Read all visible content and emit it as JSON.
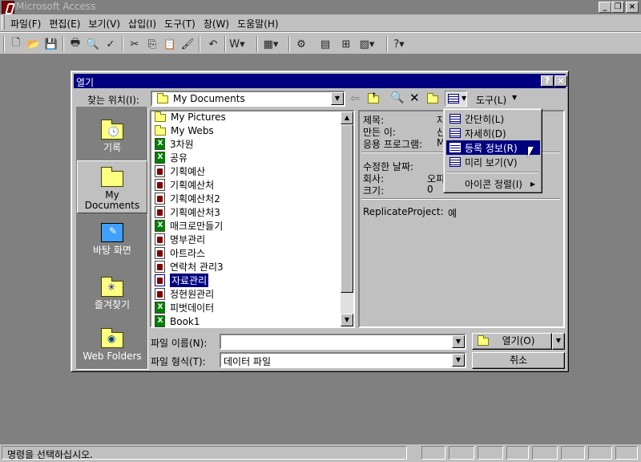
{
  "app": {
    "title": "Microsoft Access"
  },
  "menu": [
    "파일(F)",
    "편집(E)",
    "보기(V)",
    "삽입(I)",
    "도구(T)",
    "창(W)",
    "도움말(H)"
  ],
  "dialog": {
    "title": "열기",
    "help_btn": "?",
    "close_btn": "×",
    "look_in_label": "찾는 위치(I):",
    "look_in_value": "My Documents",
    "tools_label": "도구(L)",
    "places": [
      {
        "label": "기록",
        "icon": "history-folder-icon"
      },
      {
        "label": "My Documents",
        "icon": "my-documents-folder-icon"
      },
      {
        "label": "바탕 화면",
        "icon": "desktop-icon"
      },
      {
        "label": "즐겨찾기",
        "icon": "favorites-folder-icon"
      },
      {
        "label": "Web Folders",
        "icon": "web-folders-icon"
      }
    ],
    "files": [
      {
        "name": "My Pictures",
        "type": "folder"
      },
      {
        "name": "My Webs",
        "type": "folder"
      },
      {
        "name": "3차원",
        "type": "xls"
      },
      {
        "name": "공유",
        "type": "xls"
      },
      {
        "name": "기획예산",
        "type": "mdb"
      },
      {
        "name": "기획예산처",
        "type": "mdb"
      },
      {
        "name": "기획예산처2",
        "type": "mdb"
      },
      {
        "name": "기획예산처3",
        "type": "mdb"
      },
      {
        "name": "매크로만들기",
        "type": "xls"
      },
      {
        "name": "명부관리",
        "type": "mdb"
      },
      {
        "name": "아트라스",
        "type": "mdb"
      },
      {
        "name": "연락처 관리3",
        "type": "mdb"
      },
      {
        "name": "자료관리",
        "type": "mdb",
        "selected": true
      },
      {
        "name": "정현원관리",
        "type": "mdb"
      },
      {
        "name": "피벗데이터",
        "type": "xls"
      },
      {
        "name": "Book1",
        "type": "xls"
      }
    ],
    "properties": {
      "title_label": "제목:",
      "title_value": "자",
      "author_label": "만든 이:",
      "author_value": "산",
      "app_label": "응용 프로그램:",
      "app_value": "M",
      "modified_label": "수정한 날짜:",
      "company_label": "회사:",
      "company_value": "오피",
      "size_label": "크기:",
      "size_value": "0",
      "replicate_label": "ReplicateProject:",
      "replicate_value": "예"
    },
    "views_menu": [
      {
        "label": "간단히(L)"
      },
      {
        "label": "자세히(D)"
      },
      {
        "label": "등록 정보(R)",
        "highlighted": true
      },
      {
        "label": "미리 보기(V)"
      },
      {
        "label": "아이콘 정렬(I)"
      }
    ],
    "filename_label": "파일 이름(N):",
    "filename_value": "",
    "filetype_label": "파일 형식(T):",
    "filetype_value": "데이터 파일",
    "open_btn": "열기(O)",
    "cancel_btn": "취소"
  },
  "status": {
    "text": "명령을 선택하십시오."
  }
}
